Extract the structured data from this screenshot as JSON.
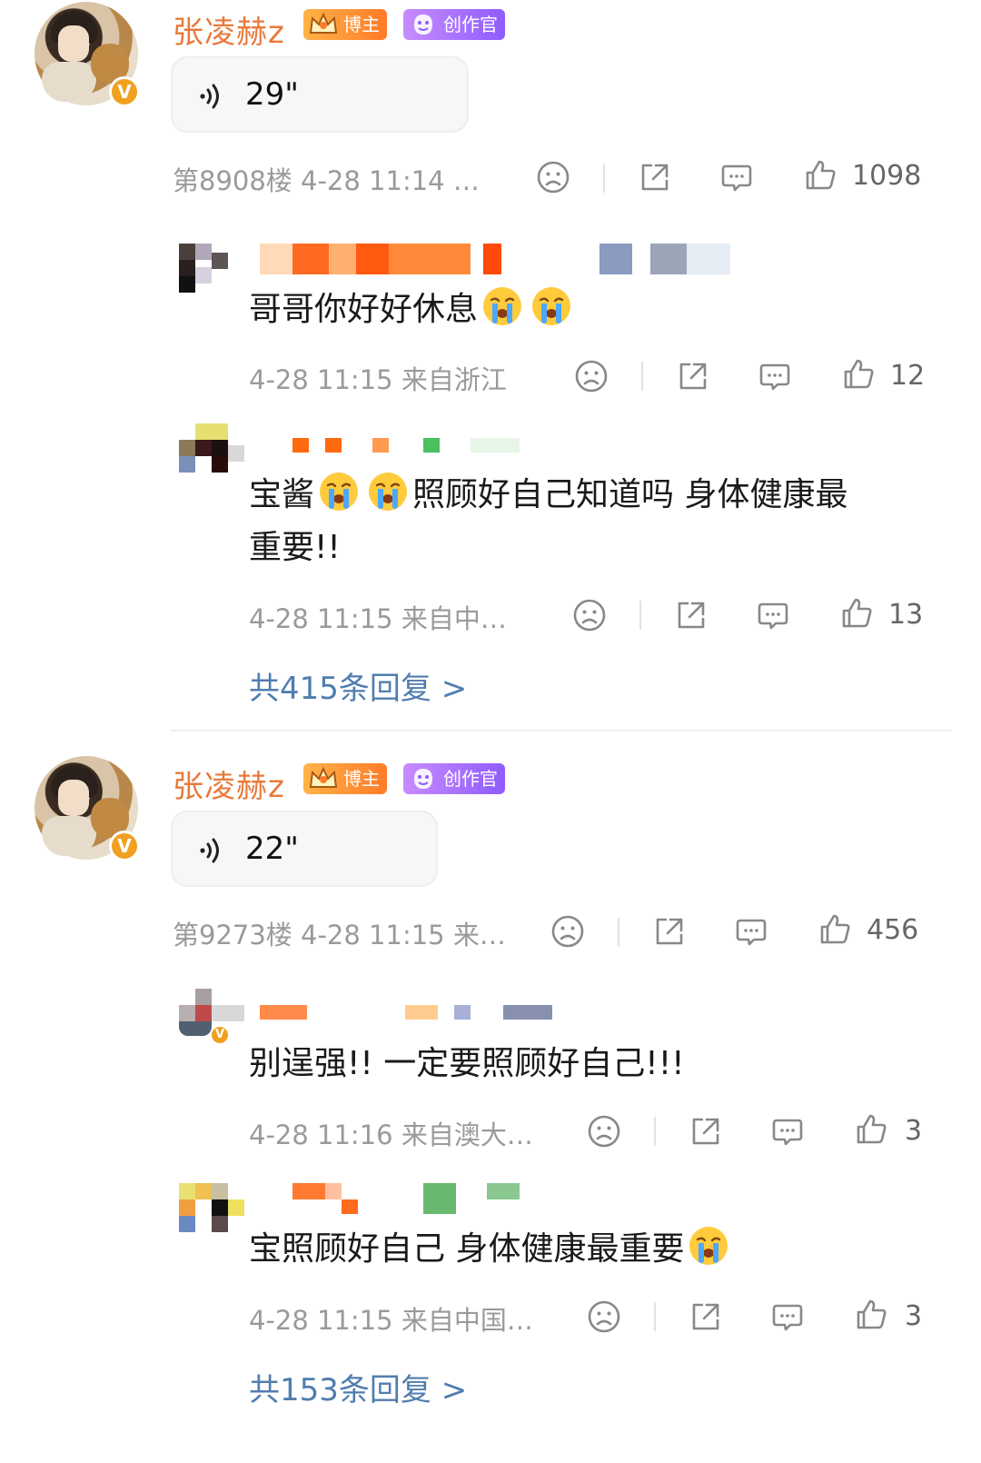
{
  "comments": [
    {
      "user_name": "张凌赫z",
      "badge_blogger": "博主",
      "badge_creator": "创作官",
      "voice_duration": "29\"",
      "floor": "第8908楼 4-28 11:14 …",
      "likes": "1098",
      "replies": [
        {
          "text": "哥哥你好好休息",
          "time": "4-28 11:15 来自浙江",
          "likes": "12"
        },
        {
          "text_line1_a": "宝酱",
          "text_line1_b": "照顾好自己知道吗 身体健康最",
          "text_line2": "重要!!",
          "time": "4-28 11:15 来自中…",
          "likes": "13"
        }
      ],
      "more_replies": "共415条回复 >"
    },
    {
      "user_name": "张凌赫z",
      "badge_blogger": "博主",
      "badge_creator": "创作官",
      "voice_duration": "22\"",
      "floor": "第9273楼 4-28 11:15 来…",
      "likes": "456",
      "replies": [
        {
          "text": "别逞强!! 一定要照顾好自己!!!",
          "time": "4-28 11:16 来自澳大…",
          "likes": "3"
        },
        {
          "text": "宝照顾好自己 身体健康最重要",
          "time": "4-28 11:15 来自中国…",
          "likes": "3"
        }
      ],
      "more_replies": "共153条回复 >"
    }
  ],
  "colors": {
    "username": "#e8793a",
    "meta_gray": "#9a9a9a",
    "link_blue": "#507daf",
    "verified_orange": "#f0a020"
  },
  "icons": [
    "sound-wave-icon",
    "dislike-face-icon",
    "share-icon",
    "comment-icon",
    "thumb-up-icon",
    "crying-emoji-icon"
  ]
}
